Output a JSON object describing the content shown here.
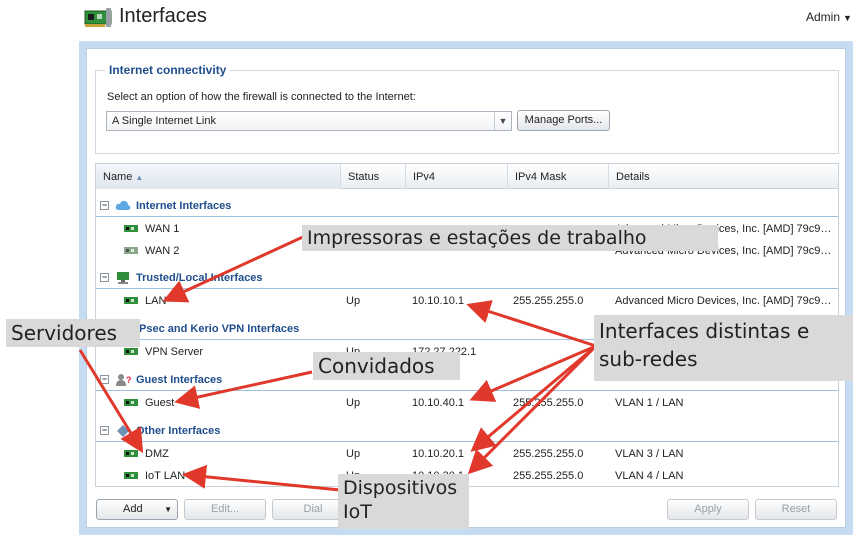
{
  "header": {
    "title": "Interfaces",
    "user": "Admin"
  },
  "connectivity": {
    "title": "Internet connectivity",
    "description": "Select an option of how the firewall is connected to the Internet:",
    "selected_option": "A Single Internet Link",
    "manage_ports_label": "Manage Ports..."
  },
  "table": {
    "columns": [
      "Name",
      "Status",
      "IPv4",
      "IPv4 Mask",
      "Details"
    ],
    "groups": [
      {
        "label": "Internet Interfaces",
        "icon": "cloud-icon",
        "rows": [
          {
            "name": "WAN 1",
            "status": "",
            "ipv4": "",
            "mask": "",
            "details": "Advanced Micro Devices, Inc. [AMD] 79c970 ..."
          },
          {
            "name": "WAN 2",
            "status": "",
            "ipv4": "",
            "mask": "",
            "details": "Advanced Micro Devices, Inc. [AMD] 79c970 ..."
          }
        ]
      },
      {
        "label": "Trusted/Local Interfaces",
        "icon": "network-icon",
        "rows": [
          {
            "name": "LAN",
            "status": "Up",
            "ipv4": "10.10.10.1",
            "mask": "255.255.255.0",
            "details": "Advanced Micro Devices, Inc. [AMD] 79c970 ..."
          }
        ]
      },
      {
        "label": "IPsec and Kerio VPN Interfaces",
        "icon": "vpn-icon",
        "rows": [
          {
            "name": "VPN Server",
            "status": "Up",
            "ipv4": "172.27.222.1",
            "mask": "",
            "details": ""
          }
        ]
      },
      {
        "label": "Guest Interfaces",
        "icon": "guest-icon",
        "rows": [
          {
            "name": "Guest",
            "status": "Up",
            "ipv4": "10.10.40.1",
            "mask": "255.255.255.0",
            "details": "VLAN 1 / LAN"
          }
        ]
      },
      {
        "label": "Other Interfaces",
        "icon": "other-icon",
        "rows": [
          {
            "name": "DMZ",
            "status": "Up",
            "ipv4": "10.10.20.1",
            "mask": "255.255.255.0",
            "details": "VLAN 3 / LAN"
          },
          {
            "name": "IoT LAN",
            "status": "Up",
            "ipv4": "10.10.30.1",
            "mask": "255.255.255.0",
            "details": "VLAN 4 / LAN"
          }
        ]
      }
    ]
  },
  "footer": {
    "add": "Add",
    "edit": "Edit...",
    "dial": "Dial",
    "apply": "Apply",
    "reset": "Reset"
  },
  "annotations": {
    "printers": "Impressoras e estações  de trabalho",
    "servers": "Servidores",
    "interfaces": "Interfaces distintas e sub-redes",
    "guests": "Convidados",
    "iot": "Dispositivos IoT"
  },
  "colors": {
    "accent": "#1f4e8c",
    "frame": "#c5dcf2",
    "arrow": "#e0382b",
    "callout": "#d9d9d9"
  }
}
